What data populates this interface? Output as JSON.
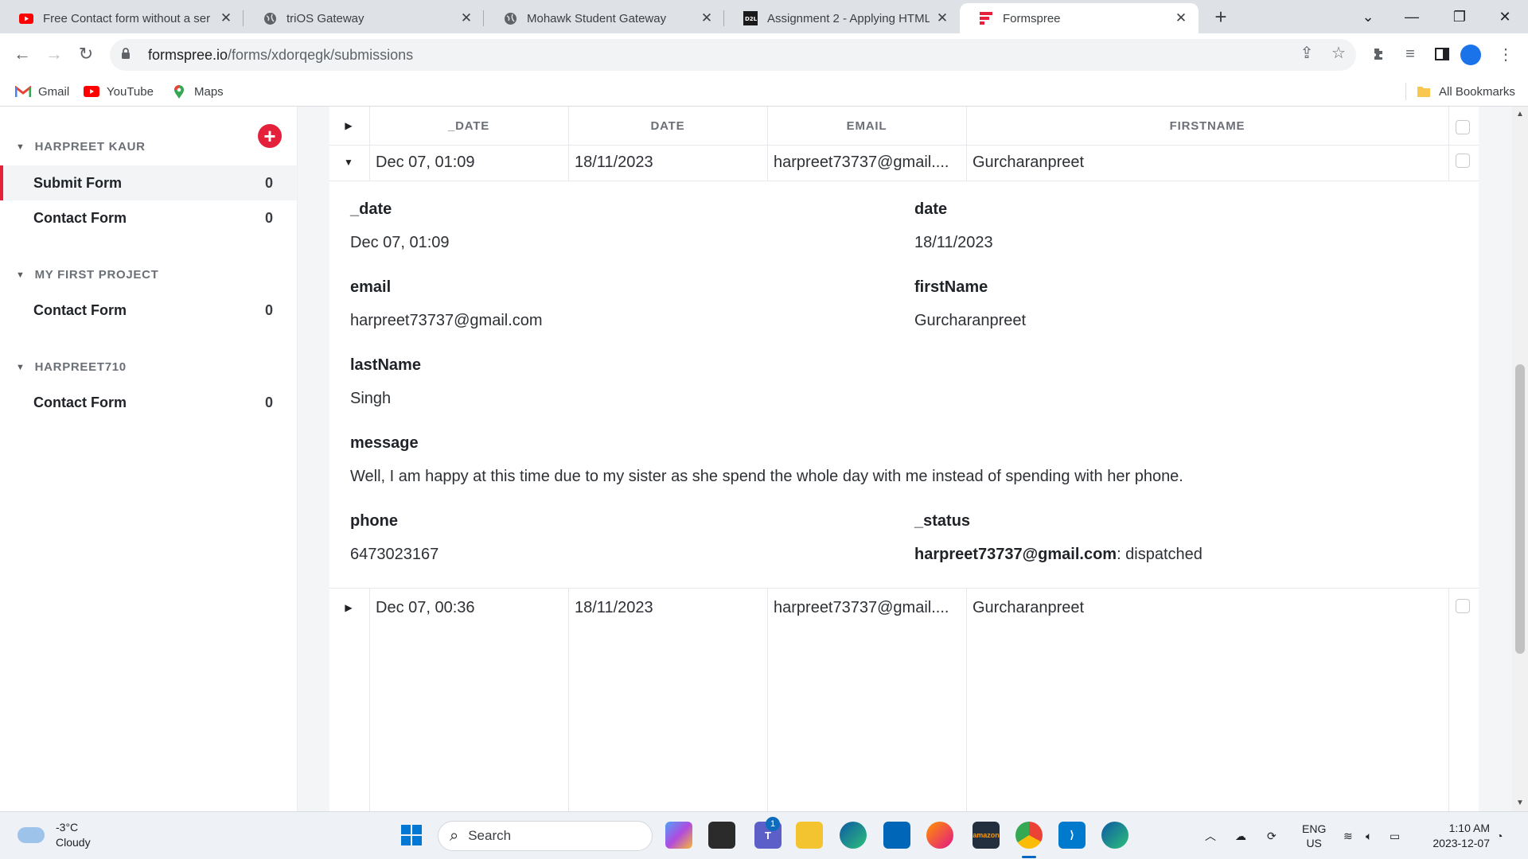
{
  "browser": {
    "tabs": [
      {
        "title": "Free Contact form without a ser",
        "icon": "youtube-icon",
        "active": false
      },
      {
        "title": "triOS Gateway",
        "icon": "globe-icon",
        "active": false
      },
      {
        "title": "Mohawk Student Gateway",
        "icon": "globe-icon",
        "active": false
      },
      {
        "title": "Assignment 2 - Applying HTML,",
        "icon": "d2l-icon",
        "active": false
      },
      {
        "title": "Formspree",
        "icon": "formspree-icon",
        "active": true
      }
    ],
    "url_host": "formspree.io",
    "url_path": "/forms/xdorqegk/submissions",
    "bookmarks": [
      {
        "label": "Gmail",
        "icon": "gmail-icon"
      },
      {
        "label": "YouTube",
        "icon": "youtube-icon"
      },
      {
        "label": "Maps",
        "icon": "maps-icon"
      }
    ],
    "all_bookmarks": "All Bookmarks"
  },
  "sidebar": {
    "projects": [
      {
        "name": "HARPREET KAUR",
        "forms": [
          {
            "name": "Submit Form",
            "count": "0",
            "active": true
          },
          {
            "name": "Contact Form",
            "count": "0",
            "active": false
          }
        ]
      },
      {
        "name": "MY FIRST PROJECT",
        "forms": [
          {
            "name": "Contact Form",
            "count": "0",
            "active": false
          }
        ]
      },
      {
        "name": "HARPREET710",
        "forms": [
          {
            "name": "Contact Form",
            "count": "0",
            "active": false
          }
        ]
      }
    ]
  },
  "table": {
    "headers": [
      "_DATE",
      "DATE",
      "EMAIL",
      "FIRSTNAME"
    ],
    "rows": [
      {
        "_date": "Dec 07, 01:09",
        "date": "18/11/2023",
        "email": "harpreet73737@gmail....",
        "firstname": "Gurcharanpreet",
        "expanded": true
      },
      {
        "_date": "Dec 07, 00:36",
        "date": "18/11/2023",
        "email": "harpreet73737@gmail....",
        "firstname": "Gurcharanpreet",
        "expanded": false
      }
    ],
    "detail": {
      "_date_label": "_date",
      "_date_value": "Dec 07, 01:09",
      "date_label": "date",
      "date_value": "18/11/2023",
      "email_label": "email",
      "email_value": "harpreet73737@gmail.com",
      "firstName_label": "firstName",
      "firstName_value": "Gurcharanpreet",
      "lastName_label": "lastName",
      "lastName_value": "Singh",
      "message_label": "message",
      "message_value": "Well, I am happy at this time due to my sister as she spend the whole day with me instead of spending with her phone.",
      "phone_label": "phone",
      "phone_value": "6473023167",
      "status_label": "_status",
      "status_email": "harpreet73737@gmail.com",
      "status_value": ": dispatched"
    }
  },
  "taskbar": {
    "temperature": "-3°C",
    "condition": "Cloudy",
    "search_label": "Search",
    "language": "ENG",
    "region": "US",
    "time": "1:10 AM",
    "date": "2023-12-07",
    "teams_badge": "1"
  },
  "colors": {
    "accent": "#e5203a",
    "chat": "#d0141f"
  }
}
